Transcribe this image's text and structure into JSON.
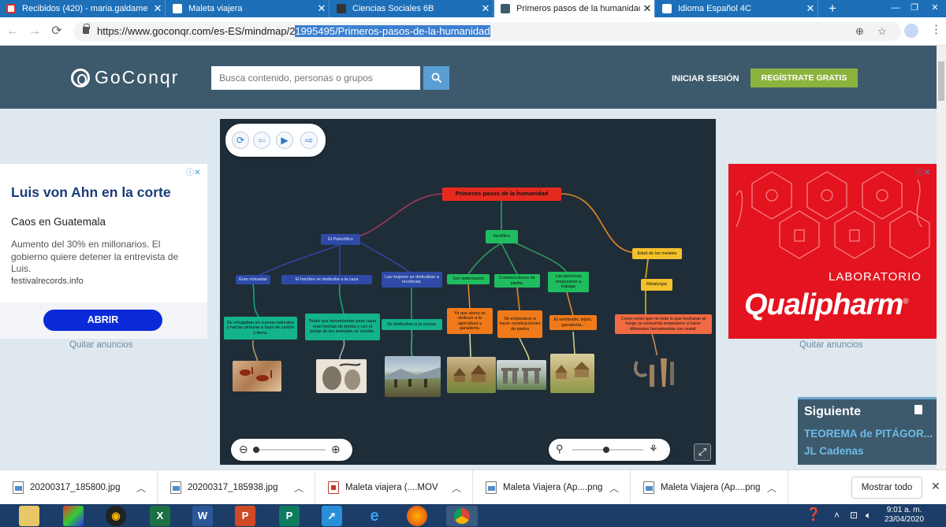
{
  "browser": {
    "tabs": [
      {
        "label": "Recibidos (420) - maria.galdame",
        "active": false
      },
      {
        "label": "Maleta viajera",
        "active": false
      },
      {
        "label": "Ciencias Sociales 6B",
        "active": false
      },
      {
        "label": "Primeros pasos de la humanidad",
        "active": true
      },
      {
        "label": "Idioma Español 4C",
        "active": false
      }
    ],
    "new_tab": "+",
    "url_prefix": "https://www.goconqr.com/es-ES/mindmap/2",
    "url_selected": "1995495/Primeros-pasos-de-la-humanidad",
    "accent": "#1d6fb8"
  },
  "site": {
    "logo_text": "GoConqr",
    "search_placeholder": "Busca contenido, personas o grupos",
    "login": "INICIAR SESIÓN",
    "register": "REGÍSTRATE GRATIS",
    "header_color": "#3d5a6c",
    "register_color": "#8cb33e"
  },
  "ad_left": {
    "title": "Luis von Ahn en la corte",
    "subtitle": "Caos en Guatemala",
    "body": "Aumento del 30% en millonarios. El gobierno quiere detener la entrevista de Luis.",
    "source": "festivalrecords.info",
    "cta": "ABRIR",
    "remove": "Quitar anuncios"
  },
  "ad_right": {
    "label": "LABORATORIO",
    "brand": "Qualipharm",
    "remove": "Quitar anuncios"
  },
  "mindmap": {
    "root": "Primeros pasos de la humanidad",
    "nodes": {
      "paleolitico": "El Paleolítico",
      "nomadas": "Eran nómadas",
      "hombre_caza": "El hombre se dedicaba a la caza",
      "cuevas": "Se refugiaban en cuevas naturales y hacían pinturas a base de carbón y tierra.",
      "herramientas": "Todas sus herramientas para cazar eran hechas de piedra y con el pelaje de los animales se vestían.",
      "mujeres": "Las mujeres se dedicaban a recolectar.",
      "cocina": "Se dedicaban a la cocina.",
      "neolitico": "Neolítico",
      "sedentarios": "Son sedentarios",
      "agricultura": "Ya que ahora se dedican a la agricultura y ganadería.",
      "construcciones": "Construcciones de piedra.",
      "empezaron_construcciones": "Se empezaron a hacer construcciones de piedra",
      "personas_trabajar": "Las personas empezaron a trabajar",
      "sembrado": "El sembrado, tejido, ganadería...",
      "metales": "Edad de los metales",
      "metalurgia": "Metalurgia",
      "fuego": "Como veían que no todo lo que hecharan al fuego se consumía empezaron a hacer diferentes herramientas con metal."
    },
    "colors": {
      "bg": "#1f2d38",
      "root": "#e62a1f",
      "paleolitico": "#2d4aa6",
      "neolitico": "#1fbd5f",
      "metales": "#f3c12b"
    }
  },
  "siguiente": {
    "title": "Siguiente",
    "line1": "TEOREMA de PITÁGOR...",
    "line2": "JL Cadenas"
  },
  "downloads": {
    "items": [
      "20200317_185800.jpg",
      "20200317_185938.jpg",
      "Maleta viajera (....MOV",
      "Maleta Viajera (Ap....png",
      "Maleta Viajera (Ap....png"
    ],
    "show_all": "Mostrar todo"
  },
  "taskbar": {
    "time": "9:01 a. m.",
    "date": "23/04/2020"
  }
}
